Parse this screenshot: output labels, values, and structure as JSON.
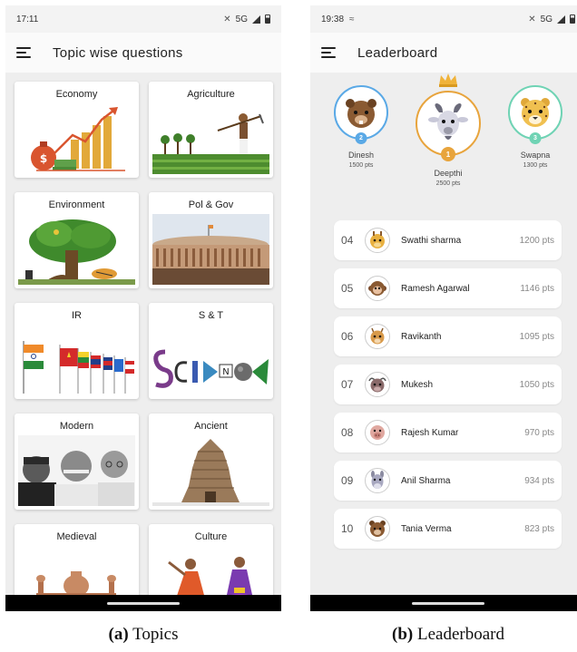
{
  "topics_screen": {
    "status": {
      "time": "17:11",
      "network": "5G"
    },
    "title": "Topic wise questions",
    "cards": [
      {
        "label": "Economy"
      },
      {
        "label": "Agriculture"
      },
      {
        "label": "Environment"
      },
      {
        "label": "Pol & Gov"
      },
      {
        "label": "IR"
      },
      {
        "label": "S & T"
      },
      {
        "label": "Modern"
      },
      {
        "label": "Ancient"
      },
      {
        "label": "Medieval"
      },
      {
        "label": "Culture"
      }
    ]
  },
  "leaderboard_screen": {
    "status": {
      "time": "19:38",
      "network": "5G"
    },
    "title": "Leaderboard",
    "podium": [
      {
        "rank": "2",
        "name": "Dinesh",
        "points": "1500 pts",
        "color": "#5aa9e6"
      },
      {
        "rank": "1",
        "name": "Deepthi",
        "points": "2500 pts",
        "color": "#e8a43c"
      },
      {
        "rank": "3",
        "name": "Swapna",
        "points": "1300 pts",
        "color": "#6fd3b4"
      }
    ],
    "rows": [
      {
        "rank": "04",
        "name": "Swathi sharma",
        "points": "1200 pts"
      },
      {
        "rank": "05",
        "name": "Ramesh Agarwal",
        "points": "1146 pts"
      },
      {
        "rank": "06",
        "name": "Ravikanth",
        "points": "1095 pts"
      },
      {
        "rank": "07",
        "name": "Mukesh",
        "points": "1050 pts"
      },
      {
        "rank": "08",
        "name": "Rajesh Kumar",
        "points": "970 pts"
      },
      {
        "rank": "09",
        "name": "Anil Sharma",
        "points": "934 pts"
      },
      {
        "rank": "10",
        "name": "Tania Verma",
        "points": "823 pts"
      }
    ]
  },
  "captions": {
    "a_tag": "(a)",
    "a_text": "Topics",
    "b_tag": "(b)",
    "b_text": "Leaderboard"
  }
}
